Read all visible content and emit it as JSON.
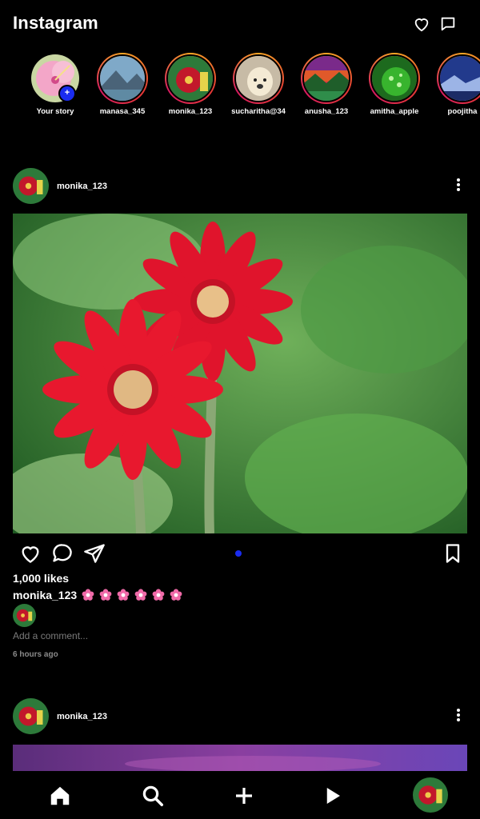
{
  "header": {
    "title": "Instagram",
    "icons": [
      "heart-icon",
      "message-icon"
    ]
  },
  "stories": [
    {
      "label": "Your story",
      "own": true,
      "add_badge": "+"
    },
    {
      "label": "manasa_345"
    },
    {
      "label": "monika_123"
    },
    {
      "label": "sucharitha@34"
    },
    {
      "label": "anusha_123"
    },
    {
      "label": "amitha_apple"
    },
    {
      "label": "poojitha"
    }
  ],
  "posts": [
    {
      "username": "monika_123",
      "likes": "1,000 likes",
      "caption_user": "monika_123",
      "caption_flowers": 6,
      "add_comment_placeholder": "Add a comment...",
      "time_ago": "6 hours ago"
    },
    {
      "username": "monika_123"
    }
  ],
  "bottom_nav": {
    "items": [
      "home-icon",
      "search-icon",
      "add-icon",
      "reels-icon",
      "profile-avatar"
    ]
  },
  "colors": {
    "background": "#000000",
    "accent_blue": "#1a2cf0",
    "story_ring": "#e53935"
  }
}
